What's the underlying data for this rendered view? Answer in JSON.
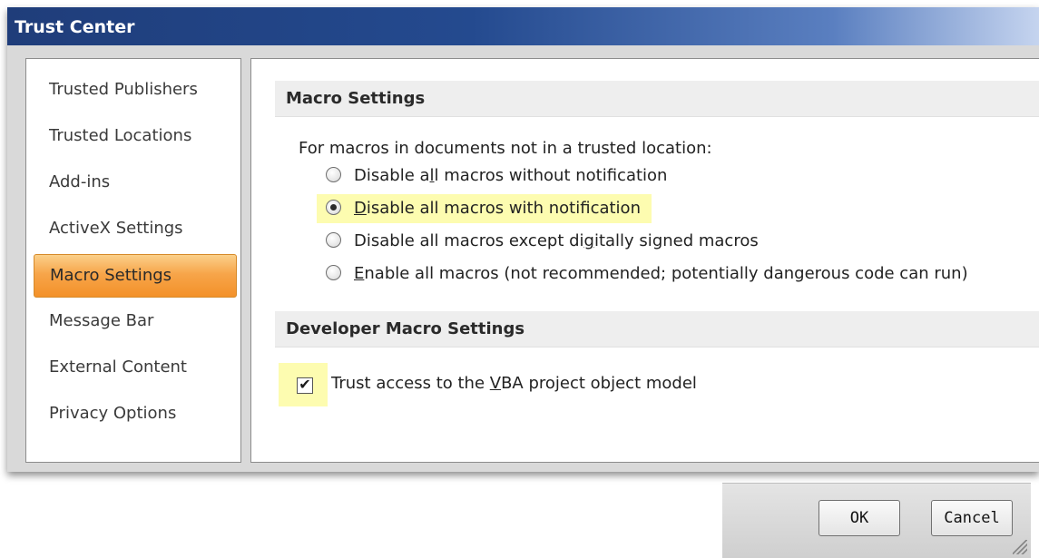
{
  "window": {
    "title": "Trust Center"
  },
  "sidebar": {
    "items": [
      {
        "label": "Trusted Publishers",
        "selected": false
      },
      {
        "label": "Trusted Locations",
        "selected": false
      },
      {
        "label": "Add-ins",
        "selected": false
      },
      {
        "label": "ActiveX Settings",
        "selected": false
      },
      {
        "label": "Macro Settings",
        "selected": true
      },
      {
        "label": "Message Bar",
        "selected": false
      },
      {
        "label": "External Content",
        "selected": false
      },
      {
        "label": "Privacy Options",
        "selected": false
      }
    ]
  },
  "macro_settings": {
    "header": "Macro Settings",
    "intro": "For macros in documents not in a trusted location:",
    "options": [
      {
        "pre": "Disable a",
        "accel": "l",
        "post": "l macros without notification",
        "selected": false
      },
      {
        "pre": "",
        "accel": "D",
        "post": "isable all macros with notification",
        "selected": true
      },
      {
        "pre": "Disable all macros except di",
        "accel": "g",
        "post": "itally signed macros",
        "selected": false
      },
      {
        "pre": "",
        "accel": "E",
        "post": "nable all macros (not recommended; potentially dangerous code can run)",
        "selected": false
      }
    ]
  },
  "developer_settings": {
    "header": "Developer Macro Settings",
    "checkbox": {
      "pre": "Trust access to the ",
      "accel": "V",
      "post": "BA project object model",
      "checked": true,
      "mark": "✔"
    }
  },
  "buttons": {
    "ok": "OK",
    "cancel": "Cancel"
  },
  "colors": {
    "title_bar": "#244a8f",
    "selected_item": "#f39129",
    "highlight": "#fdfcb0"
  }
}
